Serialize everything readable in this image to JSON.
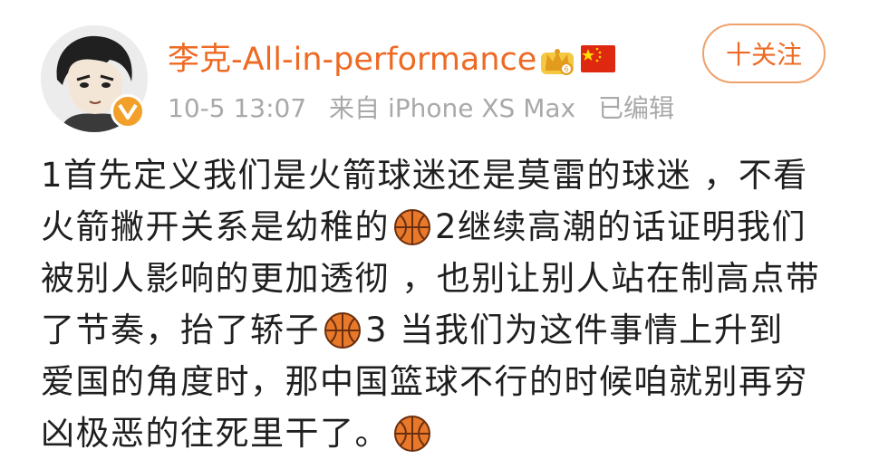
{
  "post": {
    "username": "李克-All-in-performance",
    "follow_label": "十关注",
    "meta": {
      "time": "10-5 13:07",
      "source": "来自 iPhone XS Max",
      "edited": "已编辑"
    },
    "lines": [
      [
        "1首先定义我们是火箭球迷还是莫雷的球迷 ，不看"
      ],
      [
        "火箭撇开关系是幼稚的 ",
        "2继续高潮的话证明我们"
      ],
      [
        "被别人影响的更加透彻 ，也别让别人站在制高点带"
      ],
      [
        "了节奏，抬了轿子 ",
        " 3 当我们为这件事情上升到"
      ],
      [
        "爱国的角度时，那中国篮球不行的时候咱就别再穷"
      ],
      [
        "凶极恶的往死里干了。"
      ]
    ],
    "icons": {
      "avatar": "user-avatar",
      "badge": "verified-v-badge-icon",
      "crown": "crown-icon",
      "flag": "china-flag-icon",
      "emoji": "basketball-icon"
    },
    "colors": {
      "username": "#ee6a24",
      "meta": "#a9a9a9",
      "text": "#1f1f1f",
      "badge": "#f2a02a",
      "basketball": "#e8782a"
    }
  }
}
